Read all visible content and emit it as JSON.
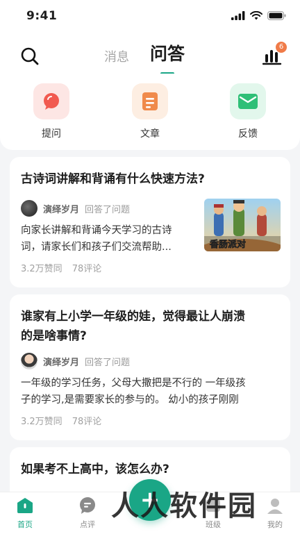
{
  "status": {
    "time": "9:41"
  },
  "header": {
    "tabs": [
      "消息",
      "问答"
    ],
    "active_tab": 1,
    "badge_count": "6"
  },
  "quick_actions": [
    {
      "label": "提问",
      "icon": "speech-bubble-icon",
      "color": "#f15a50",
      "bg": "#fde6e4"
    },
    {
      "label": "文章",
      "icon": "document-icon",
      "color": "#f08a4b",
      "bg": "#fdeee2"
    },
    {
      "label": "反馈",
      "icon": "envelope-icon",
      "color": "#2fbf77",
      "bg": "#e2f7ec"
    }
  ],
  "feed": [
    {
      "title": "古诗词讲解和背诵有什么快速方法?",
      "author": "演绎岁月",
      "action": "回答了问题",
      "excerpt_lines": [
        "向家长讲解和背诵今天学习的古诗",
        "词，请家长们和孩子们交流帮助..."
      ],
      "likes": "3.2万赞同",
      "comments": "78评论",
      "thumb_caption": "香肠派对"
    },
    {
      "title_lines": [
        "谁家有上小学一年级的娃，觉得最让人崩溃",
        "的是啥事情?"
      ],
      "author": "演绎岁月",
      "action": "回答了问题",
      "excerpt_lines": [
        "一年级的学习任务，父母大撒把是不行的 一年级孩",
        "子的学习,是需要家长的参与的。 幼小的孩子刚刚"
      ],
      "likes": "3.2万赞同",
      "comments": "78评论"
    },
    {
      "title": "如果考不上高中，该怎么办?"
    }
  ],
  "tabbar": [
    {
      "label": "首页",
      "icon": "home-icon",
      "active": true
    },
    {
      "label": "点评",
      "icon": "comment-icon",
      "active": false
    },
    {
      "label": "班级",
      "icon": "class-icon",
      "active": false
    },
    {
      "label": "我的",
      "icon": "profile-icon",
      "active": false
    }
  ],
  "fab": {
    "label": "+"
  },
  "watermark": "人人软件园",
  "colors": {
    "accent": "#1aa686",
    "badge": "#f07b48"
  }
}
